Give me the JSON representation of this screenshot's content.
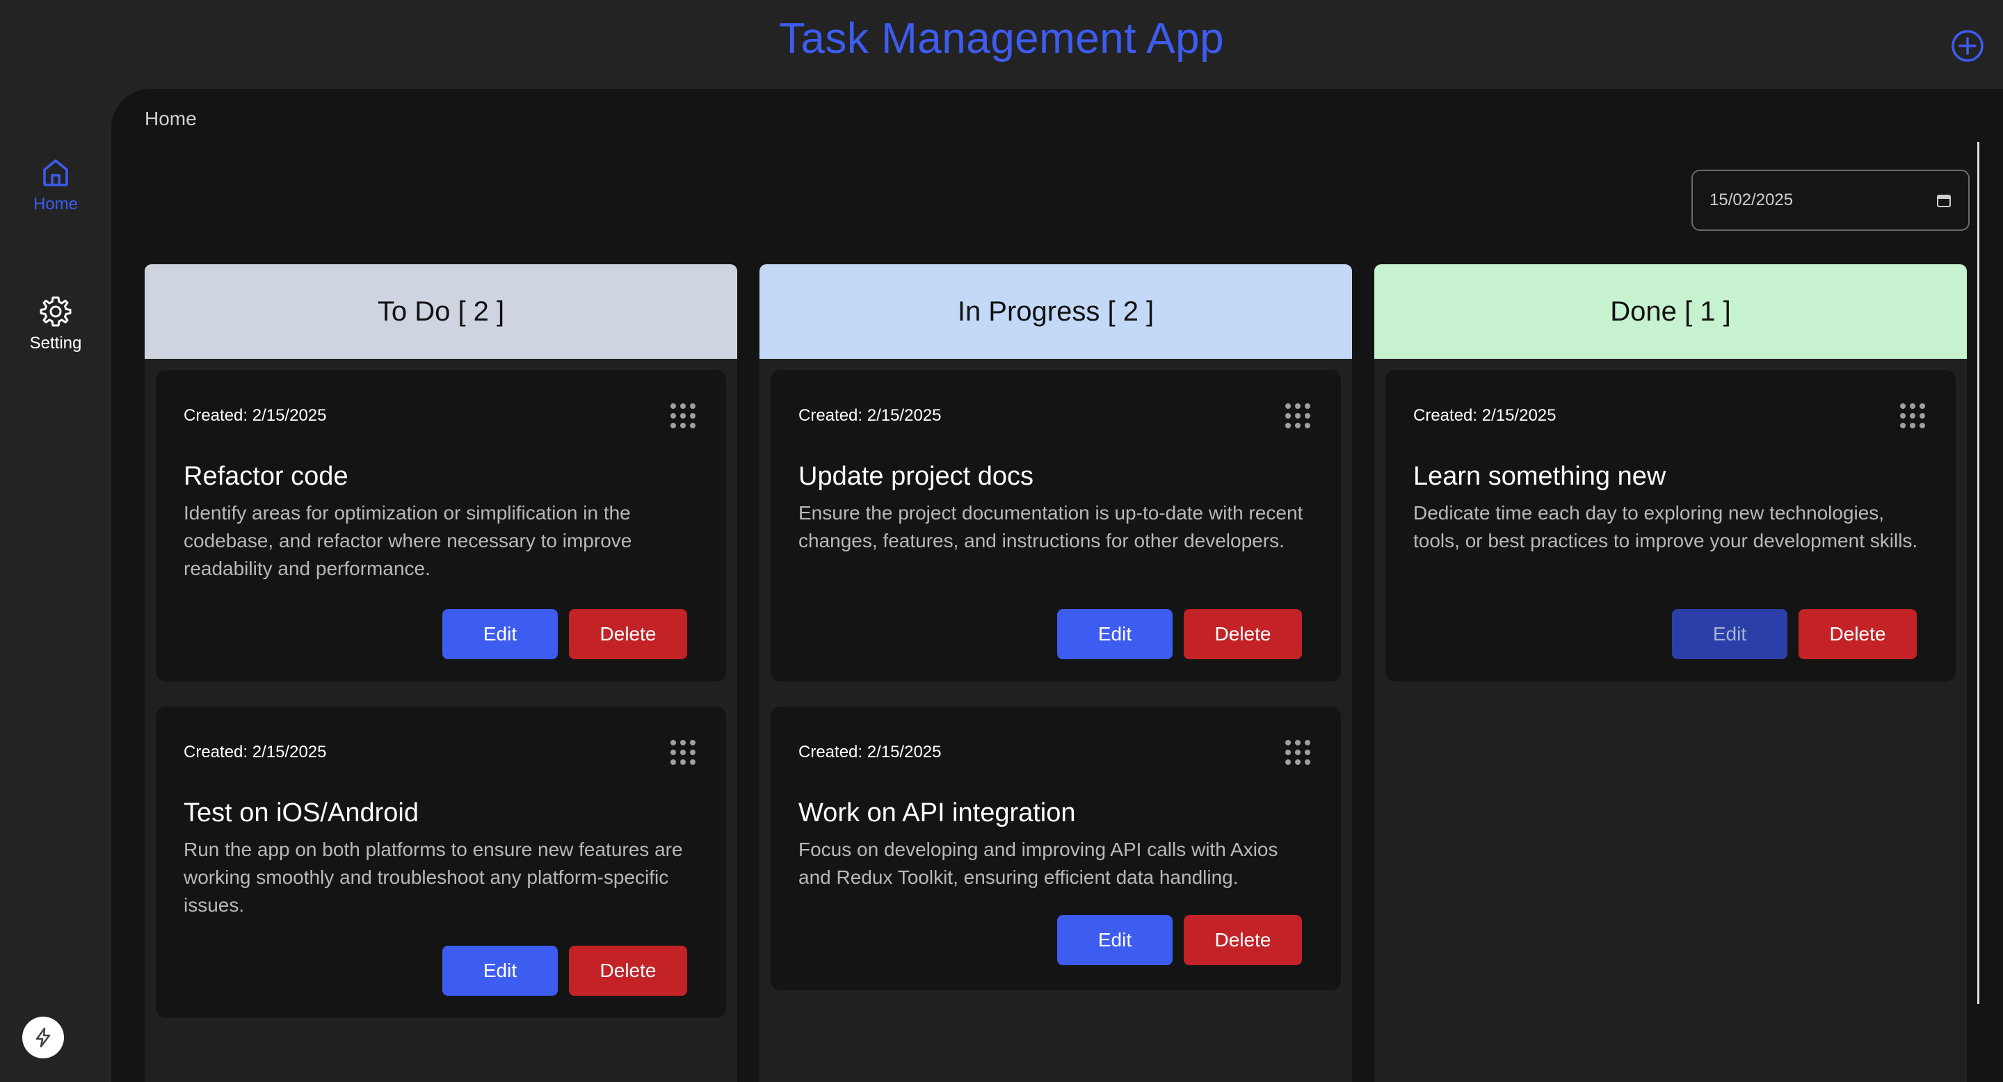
{
  "app": {
    "title": "Task Management App"
  },
  "header": {
    "add_icon": "plus-circle-icon"
  },
  "sidebar": {
    "items": [
      {
        "label": "Home",
        "icon": "home-icon",
        "active": true
      },
      {
        "label": "Setting",
        "icon": "gear-icon",
        "active": false
      }
    ],
    "bottom_icon": "bolt-icon"
  },
  "main": {
    "breadcrumb": "Home",
    "date_filter": {
      "value": "15/02/2025",
      "icon": "calendar-icon"
    }
  },
  "columns": [
    {
      "header": "To Do [ 2 ]",
      "color": "#cfd5e0",
      "cards": [
        {
          "created": "Created: 2/15/2025",
          "title": "Refactor code",
          "description": "Identify areas for optimization or simplification in the codebase, and refactor where necessary to improve readability and performance.",
          "edit_label": "Edit",
          "delete_label": "Delete"
        },
        {
          "created": "Created: 2/15/2025",
          "title": "Test on iOS/Android",
          "description": "Run the app on both platforms to ensure new features are working smoothly and troubleshoot any platform-specific issues.",
          "edit_label": "Edit",
          "delete_label": "Delete"
        }
      ]
    },
    {
      "header": "In Progress [ 2 ]",
      "color": "#c4d9f7",
      "cards": [
        {
          "created": "Created: 2/15/2025",
          "title": "Update project docs",
          "description": "Ensure the project documentation is up-to-date with recent changes, features, and instructions for other developers.",
          "edit_label": "Edit",
          "delete_label": "Delete"
        },
        {
          "created": "Created: 2/15/2025",
          "title": "Work on API integration",
          "description": "Focus on developing and improving API calls with Axios and Redux Toolkit, ensuring efficient data handling.",
          "edit_label": "Edit",
          "delete_label": "Delete"
        }
      ]
    },
    {
      "header": "Done [ 1 ]",
      "color": "#c7f2d0",
      "cards": [
        {
          "created": "Created: 2/15/2025",
          "title": "Learn something new",
          "description": "Dedicate time each day to exploring new technologies, tools, or best practices to improve your development skills.",
          "edit_label": "Edit",
          "delete_label": "Delete"
        }
      ]
    }
  ],
  "colors": {
    "accent": "#3d5cf0",
    "delete": "#c32326",
    "background": "#232323",
    "panel": "#141414"
  }
}
